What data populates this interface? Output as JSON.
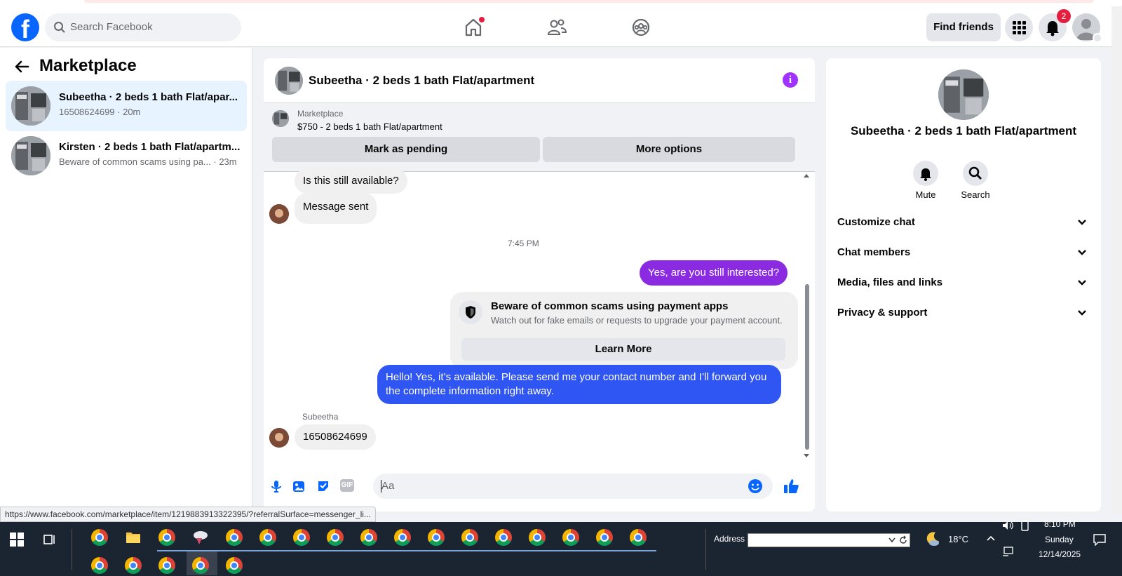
{
  "navbar": {
    "logo": "f",
    "search_placeholder": "Search Facebook",
    "find_friends": "Find friends",
    "notif_count": "2"
  },
  "left": {
    "title": "Marketplace",
    "conversations": [
      {
        "title": "Subeetha · 2 beds 1 bath Flat/apar...",
        "subtitle": "16508624699 · 20m"
      },
      {
        "title": "Kirsten · 2 beds 1 bath Flat/apartm...",
        "subtitle": "Beware of common scams using pa... · 23m"
      }
    ]
  },
  "chat": {
    "title": "Subeetha · 2 beds 1 bath Flat/apartment",
    "info_icon": "i",
    "marketplace_label": "Marketplace",
    "listing": "$750 - 2 beds 1 bath Flat/apartment",
    "mark_pending": "Mark as pending",
    "more_options": "More options",
    "messages": {
      "m1": "Is this still available?",
      "m2": "Message sent",
      "time": "7:45 PM",
      "m3": "Yes, are you still interested?",
      "scam_title": "Beware of common scams using payment apps",
      "scam_sub": "Watch out for fake emails or requests to upgrade your payment account.",
      "learn_more": "Learn More",
      "m4": "Hello! Yes, it’s available. Please send me your contact number and I’ll forward you the complete information right away.",
      "sender": "Subeetha",
      "m5": "16508624699"
    },
    "composer_placeholder": "Aa",
    "gif_label": "GIF"
  },
  "right": {
    "name": "Subeetha · 2 beds 1 bath Flat/apartment",
    "mute": "Mute",
    "search": "Search",
    "sections": [
      "Customize chat",
      "Chat members",
      "Media, files and links",
      "Privacy & support"
    ]
  },
  "status_url": "https://www.facebook.com/marketplace/item/1219883913322395/?referralSurface=messenger_li...",
  "taskbar": {
    "address_label": "Address",
    "temperature": "18°C",
    "time": "8:10 PM",
    "day": "Sunday",
    "date": "12/14/2025"
  },
  "colors": {
    "brand": "#0866ff",
    "purple_bubble": "#8a2be2",
    "blue_bubble": "#2f55f2"
  }
}
